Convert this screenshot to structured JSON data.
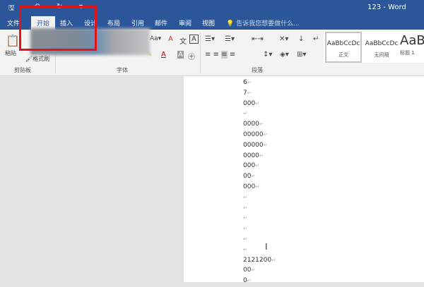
{
  "window": {
    "title": "123 - Word"
  },
  "tabs": [
    {
      "label": "文件"
    },
    {
      "label": "开始",
      "active": true
    },
    {
      "label": "插入"
    },
    {
      "label": "设计"
    },
    {
      "label": "布局"
    },
    {
      "label": "引用"
    },
    {
      "label": "邮件"
    },
    {
      "label": "审阅"
    },
    {
      "label": "视图"
    }
  ],
  "tell_me": "告诉我您想要做什么...",
  "ribbon": {
    "clipboard": {
      "paste": "粘贴",
      "format_painter": "格式刷",
      "group": "剪贴板"
    },
    "font": {
      "group": "字体"
    },
    "paragraph": {
      "group": "段落"
    },
    "styles": [
      {
        "preview": "AaBbCcDc",
        "name": "正文",
        "selected": true
      },
      {
        "preview": "AaBbCcDc",
        "name": "无间隔"
      },
      {
        "preview": "AaB",
        "name": "标题 1"
      }
    ]
  },
  "document": {
    "lines": [
      "6",
      "7",
      "000",
      "",
      "0000",
      "00000",
      "00000",
      "0000",
      "000",
      "00",
      "000",
      "",
      "",
      "",
      "",
      "",
      "",
      "2121200",
      "00",
      "0"
    ],
    "paragraph_mark": "↵"
  },
  "colors": {
    "accent": "#2b579a",
    "highlight_box": "#e0151b"
  }
}
